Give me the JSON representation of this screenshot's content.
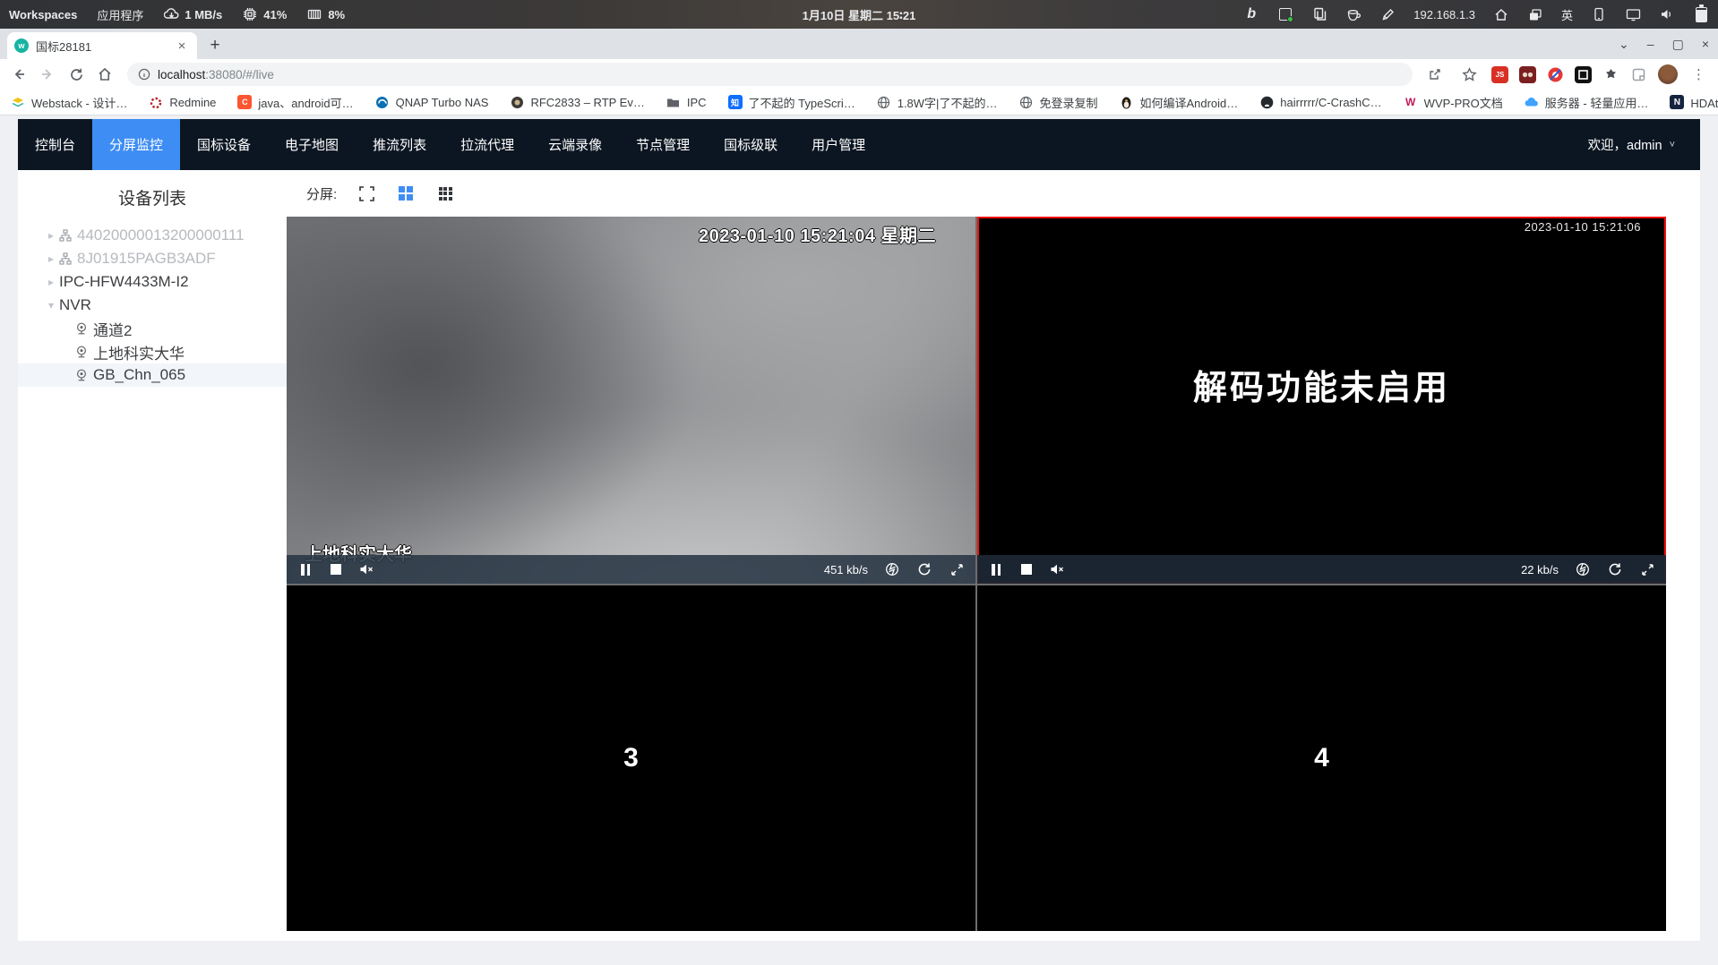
{
  "colors": {
    "accent_blue": "#3e8df5",
    "nav_bg": "#0c1622",
    "selected_cell_border": "#f50f0f",
    "favicon_teal": "#17b3a3"
  },
  "glyphs": {
    "caret_right": "▸",
    "caret_down": "▾",
    "close": "×",
    "plus": "+",
    "overflow": "»",
    "menu_dots": "⋮",
    "chevron_down": "⌄",
    "minimize": "–",
    "maximize": "▢",
    "dropdown": "˅",
    "info": "ⓘ"
  },
  "system_bar": {
    "workspaces": "Workspaces",
    "applications": "应用程序",
    "net_speed": "1 MB/s",
    "cpu_usage": "41%",
    "mem_usage": "8%",
    "datetime": "1月10日 星期二  15∶21",
    "ip_address": "192.168.1.3",
    "input_method": "英",
    "bing_glyph": "b"
  },
  "browser": {
    "tab_title": "国标28181",
    "url_host": "localhost",
    "url_rest": ":38080/#/live",
    "ext_js_label": "JS",
    "bookmarks": [
      {
        "label": "Webstack - 设计…"
      },
      {
        "label": "Redmine"
      },
      {
        "label": "java、android可…",
        "badge": "C"
      },
      {
        "label": "QNAP Turbo NAS"
      },
      {
        "label": "RFC2833 – RTP Ev…"
      },
      {
        "label": "IPC"
      },
      {
        "label": "了不起的 TypeScri…",
        "badge": "知"
      },
      {
        "label": "1.8W字|了不起的…"
      },
      {
        "label": "免登录复制"
      },
      {
        "label": "如何编译Android…"
      },
      {
        "label": "hairrrrr/C-CrashC…"
      },
      {
        "label": "WVP-PRO文档",
        "badge": "W"
      },
      {
        "label": "服务器 - 轻量应用…"
      },
      {
        "label": "HDAtmos :: 种子 *…",
        "badge": "N"
      }
    ]
  },
  "nav": {
    "items": [
      {
        "label": "控制台"
      },
      {
        "label": "分屏监控"
      },
      {
        "label": "国标设备"
      },
      {
        "label": "电子地图"
      },
      {
        "label": "推流列表"
      },
      {
        "label": "拉流代理"
      },
      {
        "label": "云端录像"
      },
      {
        "label": "节点管理"
      },
      {
        "label": "国标级联"
      },
      {
        "label": "用户管理"
      }
    ],
    "active": "分屏监控",
    "welcome": "欢迎，admin"
  },
  "sidebar": {
    "title": "设备列表",
    "tree": [
      {
        "label": "44020000013200000111"
      },
      {
        "label": "8J01915PAGB3ADF"
      },
      {
        "label": "IPC-HFW4433M-I2"
      },
      {
        "label": "NVR"
      }
    ],
    "children": [
      {
        "label": "通道2"
      },
      {
        "label": "上地科实大华"
      },
      {
        "label": "GB_Chn_065"
      }
    ]
  },
  "split_toolbar": {
    "label": "分屏:"
  },
  "videos": {
    "cell1": {
      "timestamp": "2023-01-10 15:21:04 星期二",
      "camera_label": "上地科实大华",
      "bitrate": "451 kb/s"
    },
    "cell2": {
      "message": "解码功能未启用",
      "timestamp": "2023-01-10 15:21:06",
      "bitrate": "22 kb/s"
    },
    "cell3": {
      "number": "3"
    },
    "cell4": {
      "number": "4"
    }
  }
}
